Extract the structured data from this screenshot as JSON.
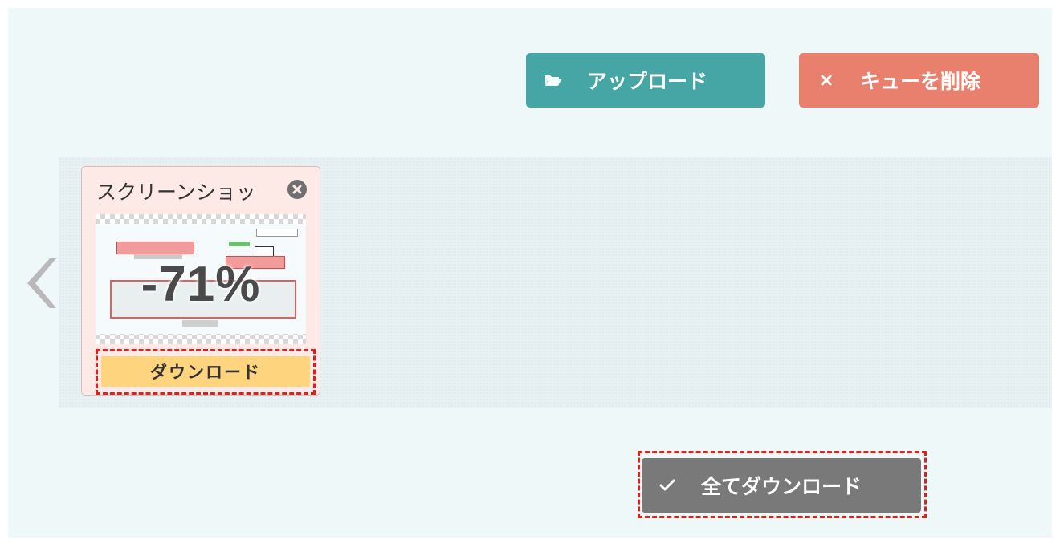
{
  "toolbar": {
    "upload_label": "アップロード",
    "upload_icon": "folder-open-icon",
    "clear_label": "キューを削除",
    "clear_icon": "close-icon"
  },
  "queue": {
    "items": [
      {
        "filename": "スクリーンショッ",
        "percent": "-71%",
        "download_label": "ダウンロード",
        "close_icon": "remove-circle-icon"
      }
    ],
    "prev_icon": "chevron-left-icon"
  },
  "footer": {
    "download_all_label": "全てダウンロード",
    "download_all_icon": "check-icon"
  },
  "colors": {
    "background": "#eef8f9",
    "upload": "#46a6a5",
    "clear": "#e97f6d",
    "download_all": "#797979",
    "card_bg": "#fde9e6",
    "card_download": "#fed47e",
    "highlight": "#e0211b"
  }
}
